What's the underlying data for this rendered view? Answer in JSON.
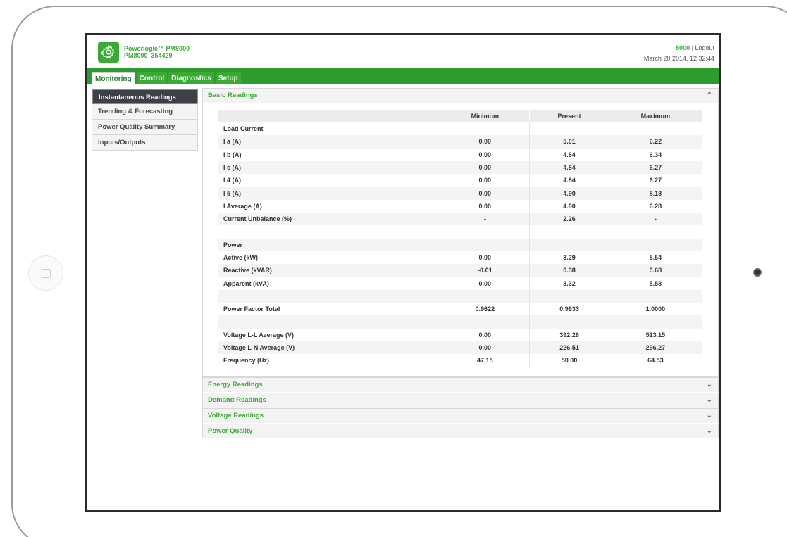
{
  "header": {
    "product_name": "Powerlogic™ PM8000",
    "device_id": "PM8000_354429",
    "user": "8000",
    "separator": "|",
    "logout_label": "Logout",
    "datetime": "March 20 2014, 12:32:44"
  },
  "tabs": [
    {
      "label": "Monitoring",
      "active": true
    },
    {
      "label": "Control",
      "active": false
    },
    {
      "label": "Diagnostics",
      "active": false
    },
    {
      "label": "Setup",
      "active": false
    }
  ],
  "sidebar": {
    "items": [
      {
        "label": "Instantaneous Readings",
        "active": true
      },
      {
        "label": "Trending & Forecasting",
        "active": false
      },
      {
        "label": "Power Quality Summary",
        "active": false
      },
      {
        "label": "Inputs/Outputs",
        "active": false
      }
    ]
  },
  "basic_readings": {
    "title": "Basic Readings",
    "columns": [
      "",
      "Minimum",
      "Present",
      "Maximum"
    ],
    "rows": [
      [
        "Load Current",
        "",
        "",
        ""
      ],
      [
        "I a (A)",
        "0.00",
        "5.01",
        "6.22"
      ],
      [
        "I b (A)",
        "0.00",
        "4.84",
        "6.34"
      ],
      [
        "I c (A)",
        "0.00",
        "4.84",
        "6.27"
      ],
      [
        "I 4 (A)",
        "0.00",
        "4.84",
        "6.27"
      ],
      [
        "I 5 (A)",
        "0.00",
        "4.90",
        "8.18"
      ],
      [
        "I Average (A)",
        "0.00",
        "4.90",
        "6.28"
      ],
      [
        "Current Unbalance (%)",
        "-",
        "2.26",
        "-"
      ],
      [
        "",
        "",
        "",
        ""
      ],
      [
        "Power",
        "",
        "",
        ""
      ],
      [
        "Active (kW)",
        "0.00",
        "3.29",
        "5.54"
      ],
      [
        "Reactive (kVAR)",
        "-0.01",
        "0.38",
        "0.68"
      ],
      [
        "Apparent (kVA)",
        "0.00",
        "3.32",
        "5.58"
      ],
      [
        "",
        "",
        "",
        ""
      ],
      [
        "Power Factor Total",
        "0.9622",
        "0.9933",
        "1.0000"
      ],
      [
        "",
        "",
        "",
        ""
      ],
      [
        "Voltage L-L Average (V)",
        "0.00",
        "392.26",
        "513.15"
      ],
      [
        "Voltage L-N Average (V)",
        "0.00",
        "226.51",
        "296.27"
      ],
      [
        "Frequency (Hz)",
        "47.15",
        "50.00",
        "64.53"
      ]
    ]
  },
  "collapsed_panels": [
    {
      "title": "Energy Readings"
    },
    {
      "title": "Demand Readings"
    },
    {
      "title": "Voltage Readings"
    },
    {
      "title": "Power Quality"
    }
  ],
  "icons": {
    "expand": "chevron-down-icon",
    "collapse": "chevron-up-icon",
    "logo": "gear-icon"
  },
  "colors": {
    "brand_green": "#3aaa35",
    "tab_bar": "#2e9b2e",
    "active_sidebar": "#3d4046"
  }
}
